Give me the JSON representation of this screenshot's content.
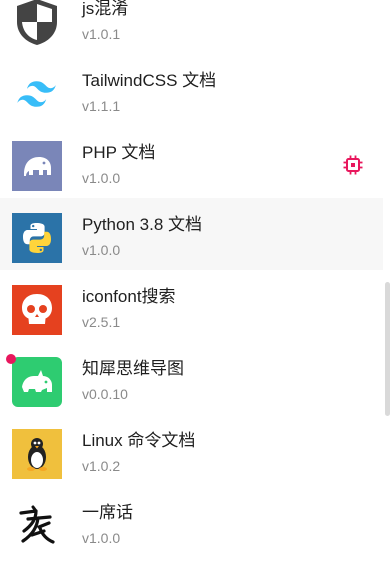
{
  "plugins": [
    {
      "title": "js混淆",
      "version": "v1.0.1",
      "icon": "shield-icon"
    },
    {
      "title": "TailwindCSS 文档",
      "version": "v1.1.1",
      "icon": "tailwind-icon"
    },
    {
      "title": "PHP 文档",
      "version": "v1.0.0",
      "icon": "php-elephant-icon",
      "badge": "chip-icon"
    },
    {
      "title": "Python 3.8 文档",
      "version": "v1.0.0",
      "icon": "python-icon"
    },
    {
      "title": "iconfont搜索",
      "version": "v2.5.1",
      "icon": "iconfont-skull-icon"
    },
    {
      "title": "知犀思维导图",
      "version": "v0.0.10",
      "icon": "rhino-icon",
      "dot": true
    },
    {
      "title": "Linux 命令文档",
      "version": "v1.0.2",
      "icon": "linux-penguin-icon"
    },
    {
      "title": "一席话",
      "version": "v1.0.0",
      "icon": "calligraphy-icon"
    }
  ],
  "colors": {
    "php_bg": "#7a86b8",
    "python_bg": "#2b73a8",
    "iconfont_bg": "#e5411f",
    "rhino_bg": "#2ecc71",
    "linux_bg": "#f0c03d",
    "tailwind": "#38bdf8",
    "badge": "#e8175d"
  }
}
